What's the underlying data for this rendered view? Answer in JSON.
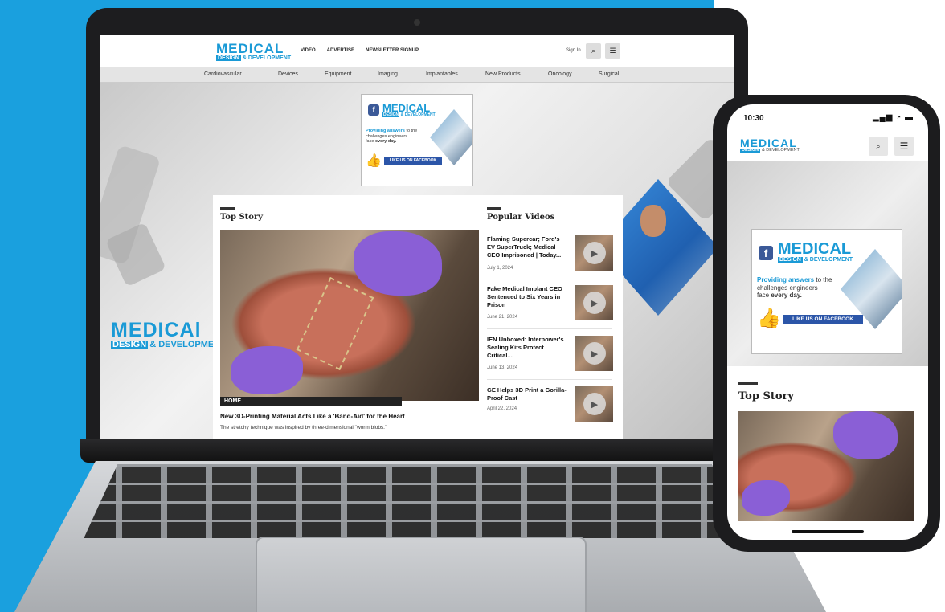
{
  "site": {
    "logo_line1": "MEDICAL",
    "logo_design": "DESIGN",
    "logo_dev": "& DEVELOPMENT",
    "hero_logo_dev": "& DEVELOPME",
    "hero_logo_line1": "MEDICAl"
  },
  "nav": {
    "links": [
      "VIDEO",
      "ADVERTISE",
      "NEWSLETTER SIGNUP"
    ],
    "signin": "Sign In"
  },
  "categories": [
    "Cardiovascular",
    "Devices",
    "Equipment",
    "Imaging",
    "Implantables",
    "New Products",
    "Oncology",
    "Surgical"
  ],
  "ad": {
    "fb_letter": "f",
    "tagline_blue": "Providing answers",
    "tagline_rest": "to the",
    "tagline_line2": "challenges engineers",
    "tagline_line3_pre": "face",
    "tagline_line3_bold": "every day.",
    "cta": "LIKE US ON FACEBOOK"
  },
  "top_story": {
    "heading": "Top Story",
    "badge": "HOME",
    "title": "New 3D-Printing Material Acts Like a 'Band-Aid' for the Heart",
    "dek": "The stretchy technique was inspired by three-dimensional \"worm blobs.\""
  },
  "popular_videos": {
    "heading": "Popular Videos",
    "items": [
      {
        "title": "Flaming Supercar; Ford's EV SuperTruck; Medical CEO Imprisoned | Today...",
        "date": "July 1, 2024"
      },
      {
        "title": "Fake Medical Implant CEO Sentenced to Six Years in Prison",
        "date": "June 21, 2024"
      },
      {
        "title": "IEN Unboxed: Interpower's Sealing Kits Protect Critical...",
        "date": "June 13, 2024"
      },
      {
        "title": "GE Helps 3D Print a Gorilla-Proof Cast",
        "date": "April 22, 2024"
      }
    ]
  },
  "phone": {
    "time": "10:30",
    "status_icons": "▂▄▆ ◔ ▬",
    "top_story": "Top Story"
  },
  "icons": {
    "search": "⌕",
    "menu": "☰",
    "play": "▶"
  },
  "colors": {
    "brand_blue": "#1a9ad6",
    "facebook_blue": "#2b55a8",
    "backdrop_blue": "#1aa0de"
  }
}
